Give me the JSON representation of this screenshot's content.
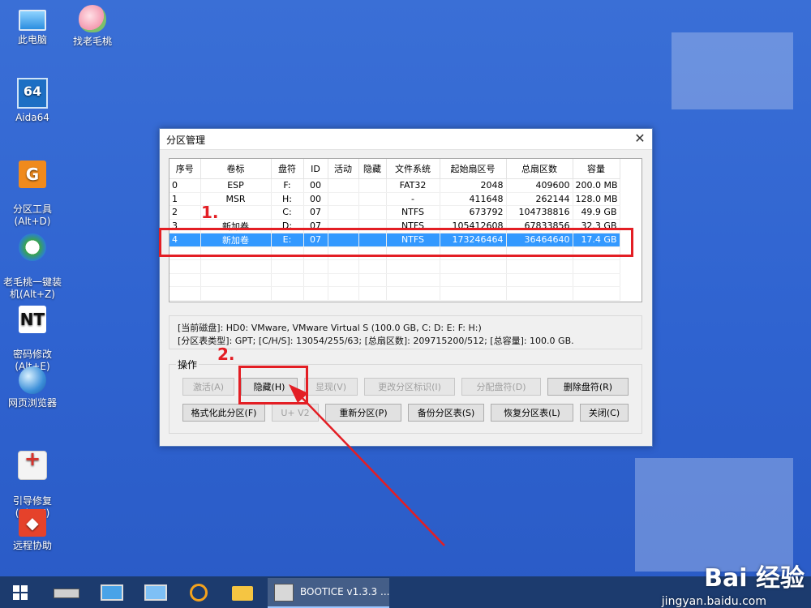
{
  "desktop": {
    "icons": [
      {
        "label": "此电脑"
      },
      {
        "label": "找老毛桃"
      },
      {
        "label": "Aida64",
        "glyph": "64"
      },
      {
        "label": "分区工具\n(Alt+D)",
        "glyph": "G"
      },
      {
        "label": "老毛桃一键装\n机(Alt+Z)"
      },
      {
        "label": "密码修改\n(Alt+E)",
        "glyph": "NT"
      },
      {
        "label": "网页浏览器"
      },
      {
        "label": "引导修复\n(Alt+F)"
      },
      {
        "label": "远程协助",
        "glyph": "◆"
      }
    ]
  },
  "dialog": {
    "title": "分区管理",
    "close_glyph": "✕",
    "columns": [
      "序号",
      "卷标",
      "盘符",
      "ID",
      "活动",
      "隐藏",
      "文件系统",
      "起始扇区号",
      "总扇区数",
      "容量"
    ],
    "rows": [
      [
        "0",
        "ESP",
        "F:",
        "00",
        "",
        "",
        "FAT32",
        "2048",
        "409600",
        "200.0 MB"
      ],
      [
        "1",
        "MSR",
        "H:",
        "00",
        "",
        "",
        "-",
        "411648",
        "262144",
        "128.0 MB"
      ],
      [
        "2",
        "",
        "C:",
        "07",
        "",
        "",
        "NTFS",
        "673792",
        "104738816",
        "49.9 GB"
      ],
      [
        "3",
        "新加卷",
        "D:",
        "07",
        "",
        "",
        "NTFS",
        "105412608",
        "67833856",
        "32.3 GB"
      ],
      [
        "4",
        "新加卷",
        "E:",
        "07",
        "",
        "",
        "NTFS",
        "173246464",
        "36464640",
        "17.4 GB"
      ]
    ],
    "selected_row": 4,
    "info": {
      "line1": "[当前磁盘]:      HD0: VMware, VMware Virtual S (100.0 GB, C: D: E: F: H:)",
      "line2": "[分区表类型]:   GPT;       [C/H/S]: 13054/255/63; [总扇区数]: 209715200/512; [总容量]: 100.0 GB."
    },
    "group_label": "操作",
    "buttons": {
      "activate": "激活(A)",
      "hide": "隐藏(H)",
      "show": "显现(V)",
      "change_id": "更改分区标识(I)",
      "assign_letter": "分配盘符(D)",
      "remove_letter": "删除盘符(R)",
      "format": "格式化此分区(F)",
      "u_v2": "U+ V2",
      "repartition": "重新分区(P)",
      "backup": "备份分区表(S)",
      "restore": "恢复分区表(L)",
      "close": "关闭(C)"
    }
  },
  "annotations": {
    "step1": "1.",
    "step2": "2.",
    "color": "#e31e24"
  },
  "taskbar": {
    "active_app": "BOOTICE v1.3.3 ..."
  },
  "watermark": {
    "brand": "Bai 经验",
    "url": "jingyan.baidu.com"
  }
}
